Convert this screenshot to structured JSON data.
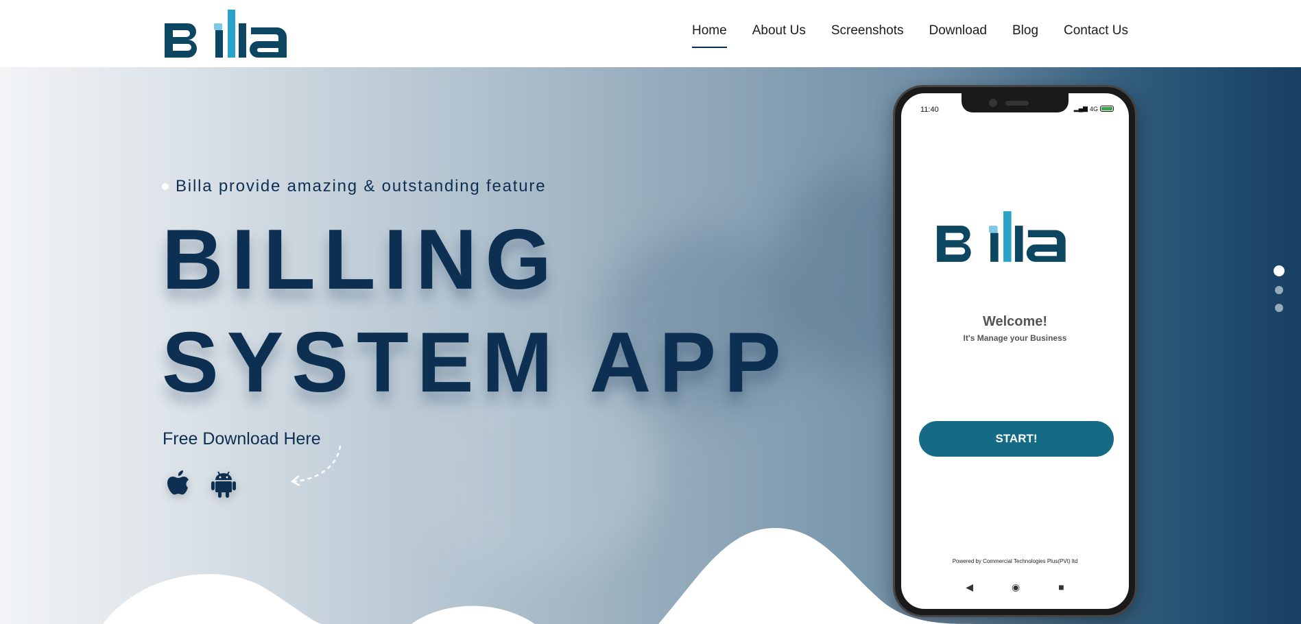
{
  "brand": {
    "name": "Billa"
  },
  "nav": {
    "items": [
      {
        "label": "Home",
        "active": true
      },
      {
        "label": "About Us",
        "active": false
      },
      {
        "label": "Screenshots",
        "active": false
      },
      {
        "label": "Download",
        "active": false
      },
      {
        "label": "Blog",
        "active": false
      },
      {
        "label": "Contact Us",
        "active": false
      }
    ]
  },
  "hero": {
    "tagline": "Billa provide amazing & outstanding feature",
    "title_line1": "BILLING",
    "title_line2": "SYSTEM APP",
    "cta_text": "Free Download Here",
    "store_icons": [
      "apple-icon",
      "android-icon"
    ]
  },
  "phone": {
    "status_time": "11:40",
    "status_network": "4G",
    "welcome_title": "Welcome!",
    "welcome_subtitle": "It's Manage your Business",
    "start_button": "START!",
    "powered_by": "Powered by Commercial Technologies Plus(PVt) ltd",
    "nav_back": "◀",
    "nav_home": "◉",
    "nav_recent": "■"
  },
  "slider": {
    "count": 3,
    "active_index": 0
  },
  "colors": {
    "primary_navy": "#0d2f52",
    "logo_dark": "#0d4661",
    "logo_light": "#2aa3c9",
    "button_teal": "#156b85"
  }
}
